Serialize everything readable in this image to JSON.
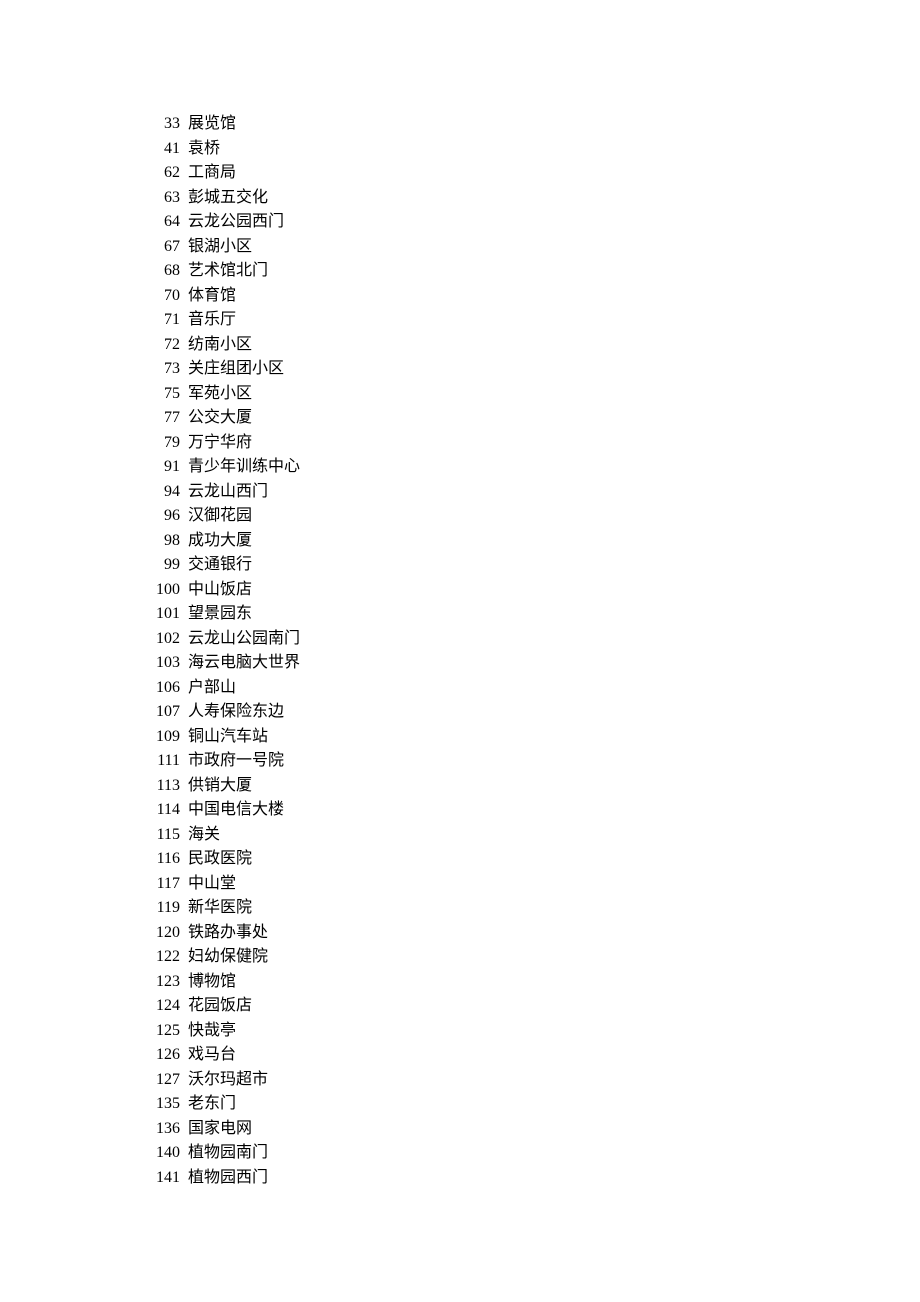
{
  "items": [
    {
      "num": "33",
      "label": "展览馆"
    },
    {
      "num": "41",
      "label": "袁桥"
    },
    {
      "num": "62",
      "label": "工商局"
    },
    {
      "num": "63",
      "label": "彭城五交化"
    },
    {
      "num": "64",
      "label": "云龙公园西门"
    },
    {
      "num": "67",
      "label": "银湖小区"
    },
    {
      "num": "68",
      "label": "艺术馆北门"
    },
    {
      "num": "70",
      "label": "体育馆"
    },
    {
      "num": "71",
      "label": "音乐厅"
    },
    {
      "num": "72",
      "label": "纺南小区"
    },
    {
      "num": "73",
      "label": "关庄组团小区"
    },
    {
      "num": "75",
      "label": "军苑小区"
    },
    {
      "num": "77",
      "label": "公交大厦"
    },
    {
      "num": "79",
      "label": "万宁华府"
    },
    {
      "num": "91",
      "label": "青少年训练中心"
    },
    {
      "num": "94",
      "label": "云龙山西门"
    },
    {
      "num": "96",
      "label": "汉御花园"
    },
    {
      "num": "98",
      "label": "成功大厦"
    },
    {
      "num": "99",
      "label": "交通银行"
    },
    {
      "num": "100",
      "label": "中山饭店"
    },
    {
      "num": "101",
      "label": "望景园东"
    },
    {
      "num": "102",
      "label": "云龙山公园南门"
    },
    {
      "num": "103",
      "label": "海云电脑大世界"
    },
    {
      "num": "106",
      "label": "户部山"
    },
    {
      "num": "107",
      "label": "人寿保险东边"
    },
    {
      "num": "109",
      "label": "铜山汽车站"
    },
    {
      "num": "111",
      "label": "市政府一号院"
    },
    {
      "num": "113",
      "label": "供销大厦"
    },
    {
      "num": "114",
      "label": "中国电信大楼"
    },
    {
      "num": "115",
      "label": "海关"
    },
    {
      "num": "116",
      "label": "民政医院"
    },
    {
      "num": "117",
      "label": "中山堂"
    },
    {
      "num": "119",
      "label": "新华医院"
    },
    {
      "num": "120",
      "label": "铁路办事处"
    },
    {
      "num": "122",
      "label": "妇幼保健院"
    },
    {
      "num": "123",
      "label": "博物馆"
    },
    {
      "num": "124",
      "label": "花园饭店"
    },
    {
      "num": "125",
      "label": "快哉亭"
    },
    {
      "num": "126",
      "label": "戏马台"
    },
    {
      "num": "127",
      "label": "沃尔玛超市"
    },
    {
      "num": "135",
      "label": "老东门"
    },
    {
      "num": "136",
      "label": "国家电网"
    },
    {
      "num": "140",
      "label": "植物园南门"
    },
    {
      "num": "141",
      "label": "植物园西门"
    }
  ]
}
